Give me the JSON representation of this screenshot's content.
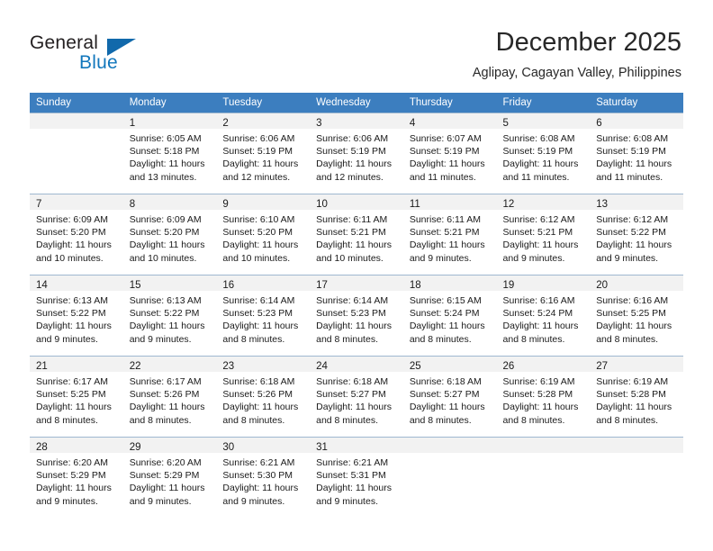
{
  "brand": {
    "name_part1": "General",
    "name_part2": "Blue",
    "flag_icon": "blue-triangle-flag-icon",
    "accent_color": "#1277bc"
  },
  "header": {
    "title": "December 2025",
    "subtitle": "Aglipay, Cagayan Valley, Philippines"
  },
  "theme": {
    "header_row_color": "#3c7ebf",
    "daynum_band_color": "#f2f2f2",
    "grid_line_color": "#9fb8d0",
    "text_color": "#1a1a1a"
  },
  "calendar": {
    "weekday_headers": [
      "Sunday",
      "Monday",
      "Tuesday",
      "Wednesday",
      "Thursday",
      "Friday",
      "Saturday"
    ],
    "weeks": [
      [
        {
          "day": "",
          "lines": []
        },
        {
          "day": "1",
          "lines": [
            "Sunrise: 6:05 AM",
            "Sunset: 5:18 PM",
            "Daylight: 11 hours",
            "and 13 minutes."
          ]
        },
        {
          "day": "2",
          "lines": [
            "Sunrise: 6:06 AM",
            "Sunset: 5:19 PM",
            "Daylight: 11 hours",
            "and 12 minutes."
          ]
        },
        {
          "day": "3",
          "lines": [
            "Sunrise: 6:06 AM",
            "Sunset: 5:19 PM",
            "Daylight: 11 hours",
            "and 12 minutes."
          ]
        },
        {
          "day": "4",
          "lines": [
            "Sunrise: 6:07 AM",
            "Sunset: 5:19 PM",
            "Daylight: 11 hours",
            "and 11 minutes."
          ]
        },
        {
          "day": "5",
          "lines": [
            "Sunrise: 6:08 AM",
            "Sunset: 5:19 PM",
            "Daylight: 11 hours",
            "and 11 minutes."
          ]
        },
        {
          "day": "6",
          "lines": [
            "Sunrise: 6:08 AM",
            "Sunset: 5:19 PM",
            "Daylight: 11 hours",
            "and 11 minutes."
          ]
        }
      ],
      [
        {
          "day": "7",
          "lines": [
            "Sunrise: 6:09 AM",
            "Sunset: 5:20 PM",
            "Daylight: 11 hours",
            "and 10 minutes."
          ]
        },
        {
          "day": "8",
          "lines": [
            "Sunrise: 6:09 AM",
            "Sunset: 5:20 PM",
            "Daylight: 11 hours",
            "and 10 minutes."
          ]
        },
        {
          "day": "9",
          "lines": [
            "Sunrise: 6:10 AM",
            "Sunset: 5:20 PM",
            "Daylight: 11 hours",
            "and 10 minutes."
          ]
        },
        {
          "day": "10",
          "lines": [
            "Sunrise: 6:11 AM",
            "Sunset: 5:21 PM",
            "Daylight: 11 hours",
            "and 10 minutes."
          ]
        },
        {
          "day": "11",
          "lines": [
            "Sunrise: 6:11 AM",
            "Sunset: 5:21 PM",
            "Daylight: 11 hours",
            "and 9 minutes."
          ]
        },
        {
          "day": "12",
          "lines": [
            "Sunrise: 6:12 AM",
            "Sunset: 5:21 PM",
            "Daylight: 11 hours",
            "and 9 minutes."
          ]
        },
        {
          "day": "13",
          "lines": [
            "Sunrise: 6:12 AM",
            "Sunset: 5:22 PM",
            "Daylight: 11 hours",
            "and 9 minutes."
          ]
        }
      ],
      [
        {
          "day": "14",
          "lines": [
            "Sunrise: 6:13 AM",
            "Sunset: 5:22 PM",
            "Daylight: 11 hours",
            "and 9 minutes."
          ]
        },
        {
          "day": "15",
          "lines": [
            "Sunrise: 6:13 AM",
            "Sunset: 5:22 PM",
            "Daylight: 11 hours",
            "and 9 minutes."
          ]
        },
        {
          "day": "16",
          "lines": [
            "Sunrise: 6:14 AM",
            "Sunset: 5:23 PM",
            "Daylight: 11 hours",
            "and 8 minutes."
          ]
        },
        {
          "day": "17",
          "lines": [
            "Sunrise: 6:14 AM",
            "Sunset: 5:23 PM",
            "Daylight: 11 hours",
            "and 8 minutes."
          ]
        },
        {
          "day": "18",
          "lines": [
            "Sunrise: 6:15 AM",
            "Sunset: 5:24 PM",
            "Daylight: 11 hours",
            "and 8 minutes."
          ]
        },
        {
          "day": "19",
          "lines": [
            "Sunrise: 6:16 AM",
            "Sunset: 5:24 PM",
            "Daylight: 11 hours",
            "and 8 minutes."
          ]
        },
        {
          "day": "20",
          "lines": [
            "Sunrise: 6:16 AM",
            "Sunset: 5:25 PM",
            "Daylight: 11 hours",
            "and 8 minutes."
          ]
        }
      ],
      [
        {
          "day": "21",
          "lines": [
            "Sunrise: 6:17 AM",
            "Sunset: 5:25 PM",
            "Daylight: 11 hours",
            "and 8 minutes."
          ]
        },
        {
          "day": "22",
          "lines": [
            "Sunrise: 6:17 AM",
            "Sunset: 5:26 PM",
            "Daylight: 11 hours",
            "and 8 minutes."
          ]
        },
        {
          "day": "23",
          "lines": [
            "Sunrise: 6:18 AM",
            "Sunset: 5:26 PM",
            "Daylight: 11 hours",
            "and 8 minutes."
          ]
        },
        {
          "day": "24",
          "lines": [
            "Sunrise: 6:18 AM",
            "Sunset: 5:27 PM",
            "Daylight: 11 hours",
            "and 8 minutes."
          ]
        },
        {
          "day": "25",
          "lines": [
            "Sunrise: 6:18 AM",
            "Sunset: 5:27 PM",
            "Daylight: 11 hours",
            "and 8 minutes."
          ]
        },
        {
          "day": "26",
          "lines": [
            "Sunrise: 6:19 AM",
            "Sunset: 5:28 PM",
            "Daylight: 11 hours",
            "and 8 minutes."
          ]
        },
        {
          "day": "27",
          "lines": [
            "Sunrise: 6:19 AM",
            "Sunset: 5:28 PM",
            "Daylight: 11 hours",
            "and 8 minutes."
          ]
        }
      ],
      [
        {
          "day": "28",
          "lines": [
            "Sunrise: 6:20 AM",
            "Sunset: 5:29 PM",
            "Daylight: 11 hours",
            "and 9 minutes."
          ]
        },
        {
          "day": "29",
          "lines": [
            "Sunrise: 6:20 AM",
            "Sunset: 5:29 PM",
            "Daylight: 11 hours",
            "and 9 minutes."
          ]
        },
        {
          "day": "30",
          "lines": [
            "Sunrise: 6:21 AM",
            "Sunset: 5:30 PM",
            "Daylight: 11 hours",
            "and 9 minutes."
          ]
        },
        {
          "day": "31",
          "lines": [
            "Sunrise: 6:21 AM",
            "Sunset: 5:31 PM",
            "Daylight: 11 hours",
            "and 9 minutes."
          ]
        },
        {
          "day": "",
          "lines": []
        },
        {
          "day": "",
          "lines": []
        },
        {
          "day": "",
          "lines": []
        }
      ]
    ]
  }
}
